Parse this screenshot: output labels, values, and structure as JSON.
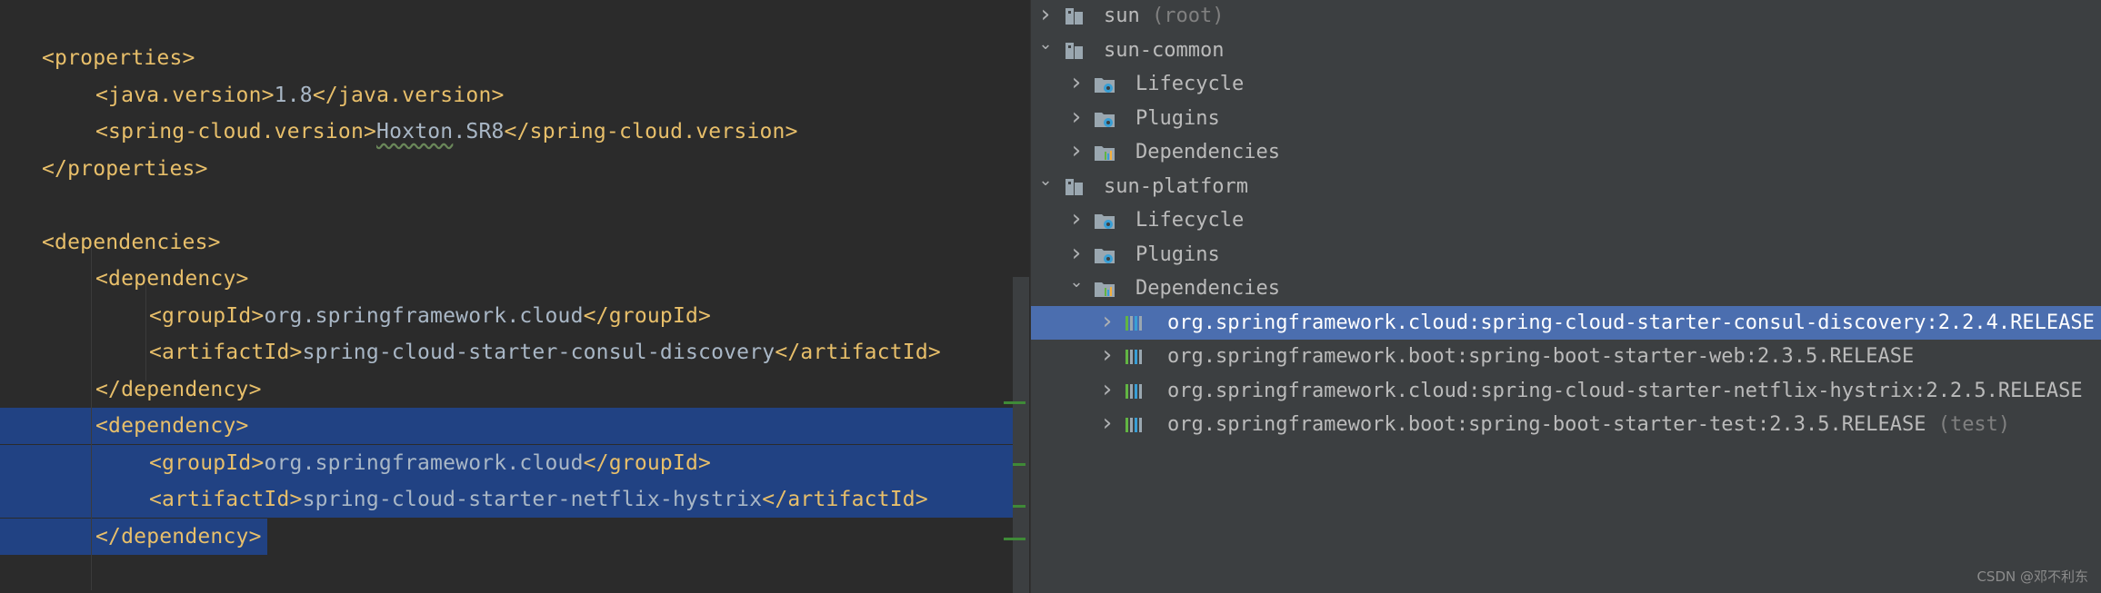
{
  "editor": {
    "lines": [
      {
        "indent": 0,
        "open": "<properties>",
        "text": "",
        "close": ""
      },
      {
        "indent": 1,
        "open": "<java.version>",
        "text": "1.8",
        "close": "</java.version>"
      },
      {
        "indent": 1,
        "open": "<spring-cloud.version>",
        "text_typo": "Hoxton",
        "text": ".SR8",
        "close": "</spring-cloud.version>"
      },
      {
        "indent": 0,
        "open": "</properties>",
        "text": "",
        "close": ""
      },
      {
        "indent": 0,
        "open": "",
        "text": "",
        "close": ""
      },
      {
        "indent": 0,
        "open": "<dependencies>",
        "text": "",
        "close": ""
      },
      {
        "indent": 1,
        "open": "<dependency>",
        "text": "",
        "close": ""
      },
      {
        "indent": 2,
        "open": "<groupId>",
        "text": "org.springframework.cloud",
        "close": "</groupId>"
      },
      {
        "indent": 2,
        "open": "<artifactId>",
        "text": "spring-cloud-starter-consul-discovery",
        "close": "</artifactId>"
      },
      {
        "indent": 1,
        "open": "</dependency>",
        "text": "",
        "close": ""
      },
      {
        "indent": 1,
        "open": "<dependency>",
        "text": "",
        "close": "",
        "selected": true
      },
      {
        "indent": 2,
        "open": "<groupId>",
        "text": "org.springframework.cloud",
        "close": "</groupId>",
        "selected": true
      },
      {
        "indent": 2,
        "open": "<artifactId>",
        "text": "spring-cloud-starter-netflix-hystrix",
        "close": "</artifactId>",
        "selected": true
      },
      {
        "indent": 1,
        "open": "</dependency>",
        "text": "",
        "close": "",
        "selected": "partial"
      }
    ]
  },
  "maven_tree": {
    "nodes": [
      {
        "level": 0,
        "expanded": false,
        "icon": "maven-module-icon",
        "label": "sun",
        "suffix": " (root)"
      },
      {
        "level": 0,
        "expanded": true,
        "icon": "maven-module-icon",
        "label": "sun-common",
        "suffix": ""
      },
      {
        "level": 1,
        "expanded": false,
        "icon": "lifecycle-folder-icon",
        "label": "Lifecycle",
        "suffix": ""
      },
      {
        "level": 1,
        "expanded": false,
        "icon": "plugins-folder-icon",
        "label": "Plugins",
        "suffix": ""
      },
      {
        "level": 1,
        "expanded": false,
        "icon": "dependencies-folder-icon",
        "label": "Dependencies",
        "suffix": ""
      },
      {
        "level": 0,
        "expanded": true,
        "icon": "maven-module-icon",
        "label": "sun-platform",
        "suffix": ""
      },
      {
        "level": 1,
        "expanded": false,
        "icon": "lifecycle-folder-icon",
        "label": "Lifecycle",
        "suffix": ""
      },
      {
        "level": 1,
        "expanded": false,
        "icon": "plugins-folder-icon",
        "label": "Plugins",
        "suffix": ""
      },
      {
        "level": 1,
        "expanded": true,
        "icon": "dependencies-folder-icon",
        "label": "Dependencies",
        "suffix": ""
      },
      {
        "level": 2,
        "expanded": false,
        "icon": "library-icon",
        "label": "org.springframework.cloud:spring-cloud-starter-consul-discovery:2.2.4.RELEASE",
        "suffix": "",
        "selected": true
      },
      {
        "level": 2,
        "expanded": false,
        "icon": "library-icon",
        "label": "org.springframework.boot:spring-boot-starter-web:2.3.5.RELEASE",
        "suffix": ""
      },
      {
        "level": 2,
        "expanded": false,
        "icon": "library-icon",
        "label": "org.springframework.cloud:spring-cloud-starter-netflix-hystrix:2.2.5.RELEASE",
        "suffix": ""
      },
      {
        "level": 2,
        "expanded": false,
        "icon": "library-icon",
        "label": "org.springframework.boot:spring-boot-starter-test:2.3.5.RELEASE",
        "suffix": " (test)"
      }
    ]
  },
  "watermark": "CSDN @邓不利东",
  "colors": {
    "editor_bg": "#2b2b2b",
    "tree_bg": "#3c3f41",
    "xml_tag": "#e8bf6a",
    "xml_text": "#a9b7c6",
    "selection": "#214283",
    "tree_selection": "#4b6eaf"
  }
}
